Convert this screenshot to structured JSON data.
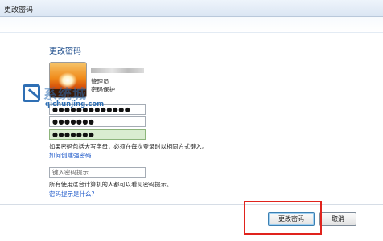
{
  "window": {
    "title": "更改密码"
  },
  "page": {
    "heading": "更改密码"
  },
  "account": {
    "role": "管理员",
    "protection": "密码保护"
  },
  "fields": {
    "current_password": "●●●●●●●●●●●●●",
    "new_password": "●●●●●●●",
    "confirm_password": "●●●●●●●",
    "hint_placeholder": "键入密码提示"
  },
  "messages": {
    "caps_notice": "如果密码包括大写字母，必须在每次登录时以相同方式键入。",
    "hint_notice": "所有使用这台计算机的人都可以看见密码提示。"
  },
  "links": {
    "create_strong": "如何创建强密码",
    "what_is_hint": "密码提示是什么?"
  },
  "buttons": {
    "change": "更改密码",
    "cancel": "取消"
  },
  "watermark": {
    "text": "系统城",
    "url": "qichunjing.com"
  },
  "colors": {
    "link": "#1a56c8",
    "highlight_box": "#e0231d",
    "confirm_ok": "#d9ecd0"
  }
}
